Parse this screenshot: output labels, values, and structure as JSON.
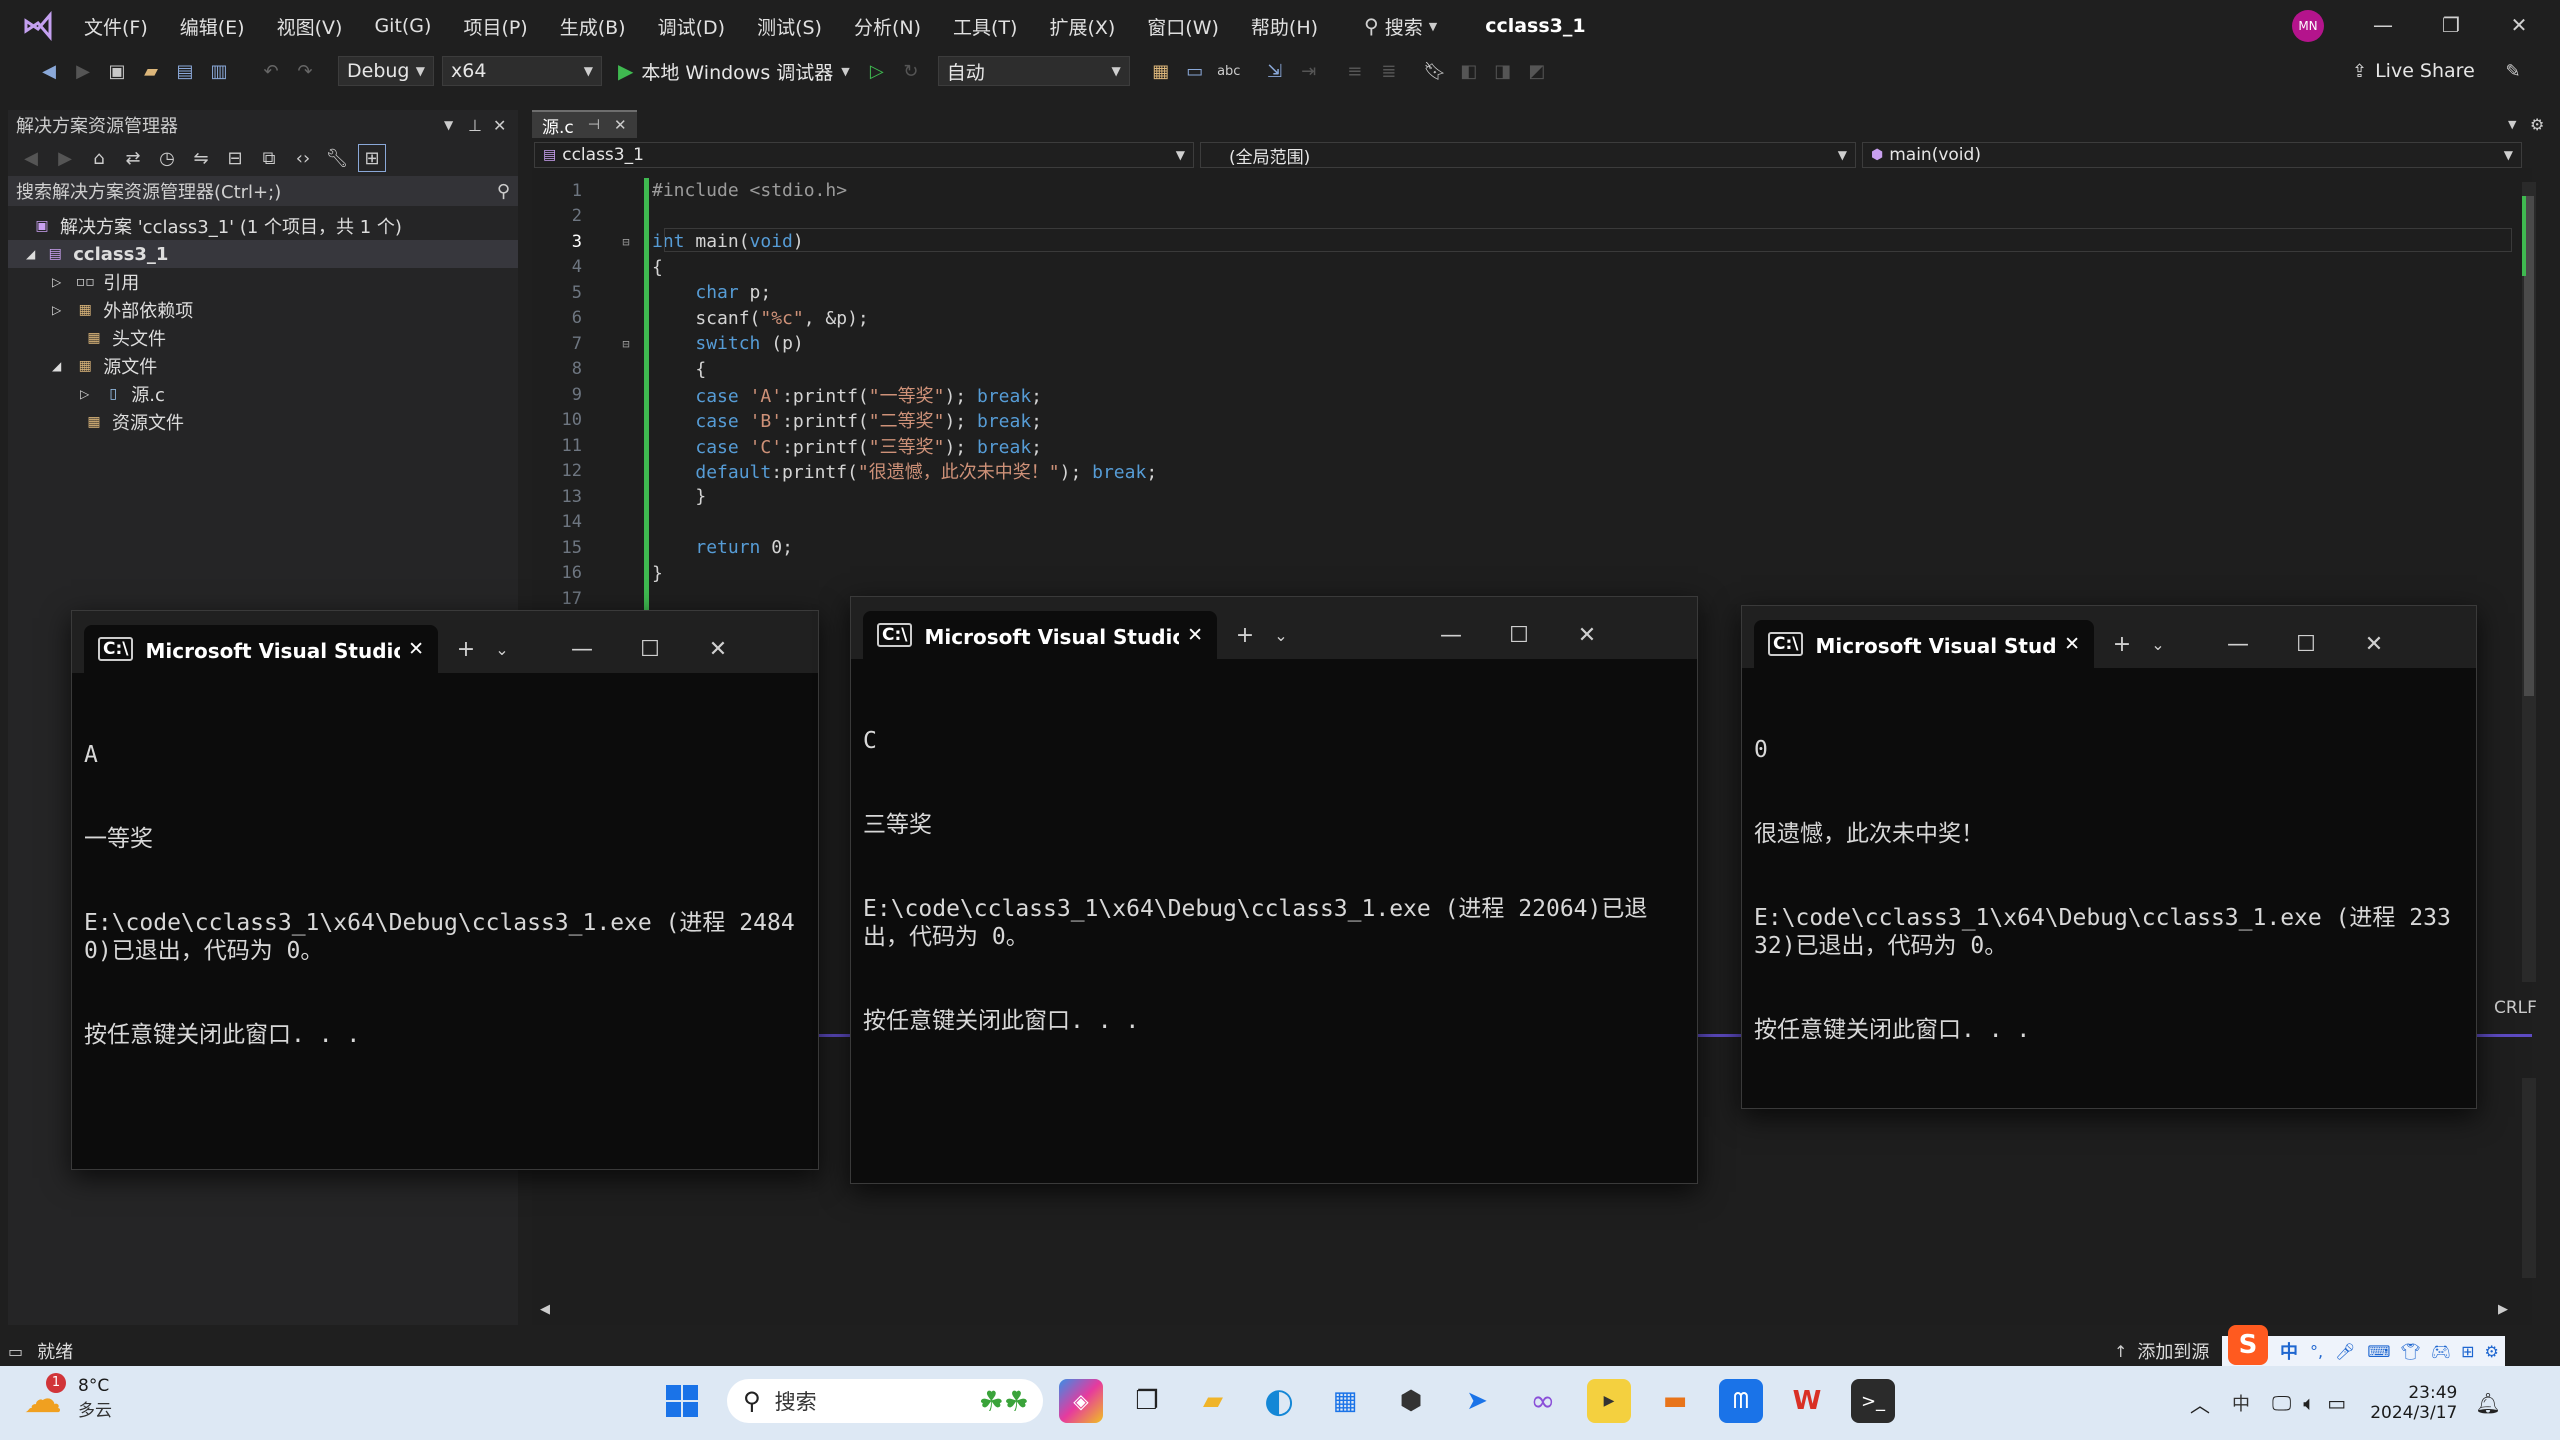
{
  "menu": [
    "文件(F)",
    "编辑(E)",
    "视图(V)",
    "Git(G)",
    "项目(P)",
    "生成(B)",
    "调试(D)",
    "测试(S)",
    "分析(N)",
    "工具(T)",
    "扩展(X)",
    "窗口(W)",
    "帮助(H)"
  ],
  "search_label": "搜索",
  "solution_title": "cclass3_1",
  "user_initials": "MN",
  "toolbar": {
    "config": "Debug",
    "platform": "x64",
    "run_label": "本地 Windows 调试器",
    "auto_label": "自动",
    "live_share": "Live Share"
  },
  "solution_explorer": {
    "title": "解决方案资源管理器",
    "search_placeholder": "搜索解决方案资源管理器(Ctrl+;)",
    "tree": {
      "solution": "解决方案 'cclass3_1' (1 个项目，共 1 个)",
      "project": "cclass3_1",
      "references": "引用",
      "external_deps": "外部依赖项",
      "headers": "头文件",
      "sources": "源文件",
      "source_file": "源.c",
      "resources": "资源文件"
    }
  },
  "editor": {
    "tab_label": "源.c",
    "nav_project": "cclass3_1",
    "nav_scope": "(全局范围)",
    "nav_function": "main(void)",
    "line_numbers": [
      "1",
      "2",
      "3",
      "4",
      "5",
      "6",
      "7",
      "8",
      "9",
      "10",
      "11",
      "12",
      "13",
      "14",
      "15",
      "16",
      "17"
    ],
    "code": [
      "#include <stdio.h>",
      "",
      "int main(void)",
      "{",
      "    char p;",
      "    scanf(\"%c\", &p);",
      "    switch (p)",
      "    {",
      "    case 'A':printf(\"一等奖\"); break;",
      "    case 'B':printf(\"二等奖\"); break;",
      "    case 'C':printf(\"三等奖\"); break;",
      "    default:printf(\"很遗憾，此次未中奖！\"); break;",
      "    }",
      "",
      "    return 0;",
      "}",
      ""
    ],
    "crlf": "CRLF"
  },
  "consoles": [
    {
      "title": "Microsoft Visual Studio 调i",
      "lines": [
        "A",
        "一等奖",
        "E:\\code\\cclass3_1\\x64\\Debug\\cclass3_1.exe (进程 24840)已退出，代码为 0。",
        "按任意键关闭此窗口. . ."
      ]
    },
    {
      "title": "Microsoft Visual Studio 调i",
      "lines": [
        "C",
        "三等奖",
        "E:\\code\\cclass3_1\\x64\\Debug\\cclass3_1.exe (进程 22064)已退出，代码为 0。",
        "按任意键关闭此窗口. . ."
      ]
    },
    {
      "title": "Microsoft Visual Studio 诽",
      "lines": [
        "0",
        "很遗憾，此次未中奖！",
        "E:\\code\\cclass3_1\\x64\\Debug\\cclass3_1.exe (进程 23332)已退出，代码为 0。",
        "按任意键关闭此窗口. . ."
      ]
    }
  ],
  "statusbar": {
    "ready": "就绪",
    "add_to_source": "添加到源",
    "ime_label": "中"
  },
  "taskbar": {
    "weather_temp": "8°C",
    "weather_desc": "多云",
    "weather_badge": "1",
    "search_label": "搜索",
    "time": "23:49",
    "date": "2024/3/17",
    "ime": "中"
  }
}
